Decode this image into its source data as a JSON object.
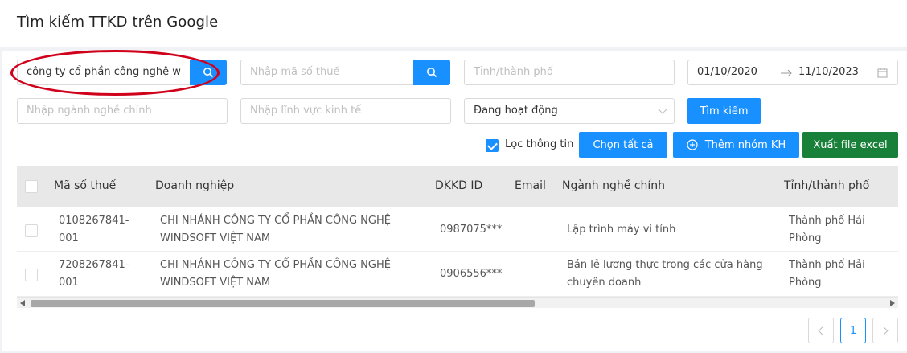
{
  "page": {
    "title": "Tìm kiếm TTKD trên Google"
  },
  "filters": {
    "company_search_value": "công ty cổ phần công nghệ w",
    "tax_code_placeholder": "Nhập mã số thuế",
    "province_placeholder": "Tỉnh/thành phố",
    "date_from": "01/10/2020",
    "date_to": "11/10/2023",
    "main_industry_placeholder": "Nhập ngành nghề chính",
    "economic_sector_placeholder": "Nhập lĩnh vực kinh tế",
    "status_value": "Đang hoạt động",
    "search_button": "Tìm kiếm"
  },
  "actions": {
    "filter_info_label": "Lọc thông tin",
    "filter_info_checked": true,
    "select_all": "Chọn tất cả",
    "add_group": "Thêm nhóm KH",
    "export_excel": "Xuất file excel"
  },
  "table": {
    "columns": [
      "Mã số thuế",
      "Doanh nghiệp",
      "DKKD ID",
      "Email",
      "Ngành nghề chính",
      "Tỉnh/thành phố"
    ],
    "rows": [
      {
        "tax_code": [
          "0108267841-",
          "001"
        ],
        "company": [
          "CHI NHÁNH CÔNG TY CỔ PHẦN CÔNG NGHỆ",
          "WINDSOFT VIỆT NAM"
        ],
        "dkkd_id": "0987075***",
        "email": "",
        "industry": [
          "Lập trình máy vi tính"
        ],
        "province": [
          "Thành phố Hải",
          "Phòng"
        ]
      },
      {
        "tax_code": [
          "7208267841-",
          "001"
        ],
        "company": [
          "CHI NHÁNH CÔNG TY CỔ PHẦN CÔNG NGHỆ",
          "WINDSOFT VIỆT NAM"
        ],
        "dkkd_id": "0906556***",
        "email": "",
        "industry": [
          "Bán lẻ lương thực trong các cửa hàng",
          "chuyên doanh"
        ],
        "province": [
          "Thành phố Hải",
          "Phòng"
        ]
      }
    ]
  },
  "pagination": {
    "current": "1"
  },
  "colors": {
    "primary": "#1890ff",
    "export_green": "#188038",
    "annotation_red": "#d0021b"
  }
}
